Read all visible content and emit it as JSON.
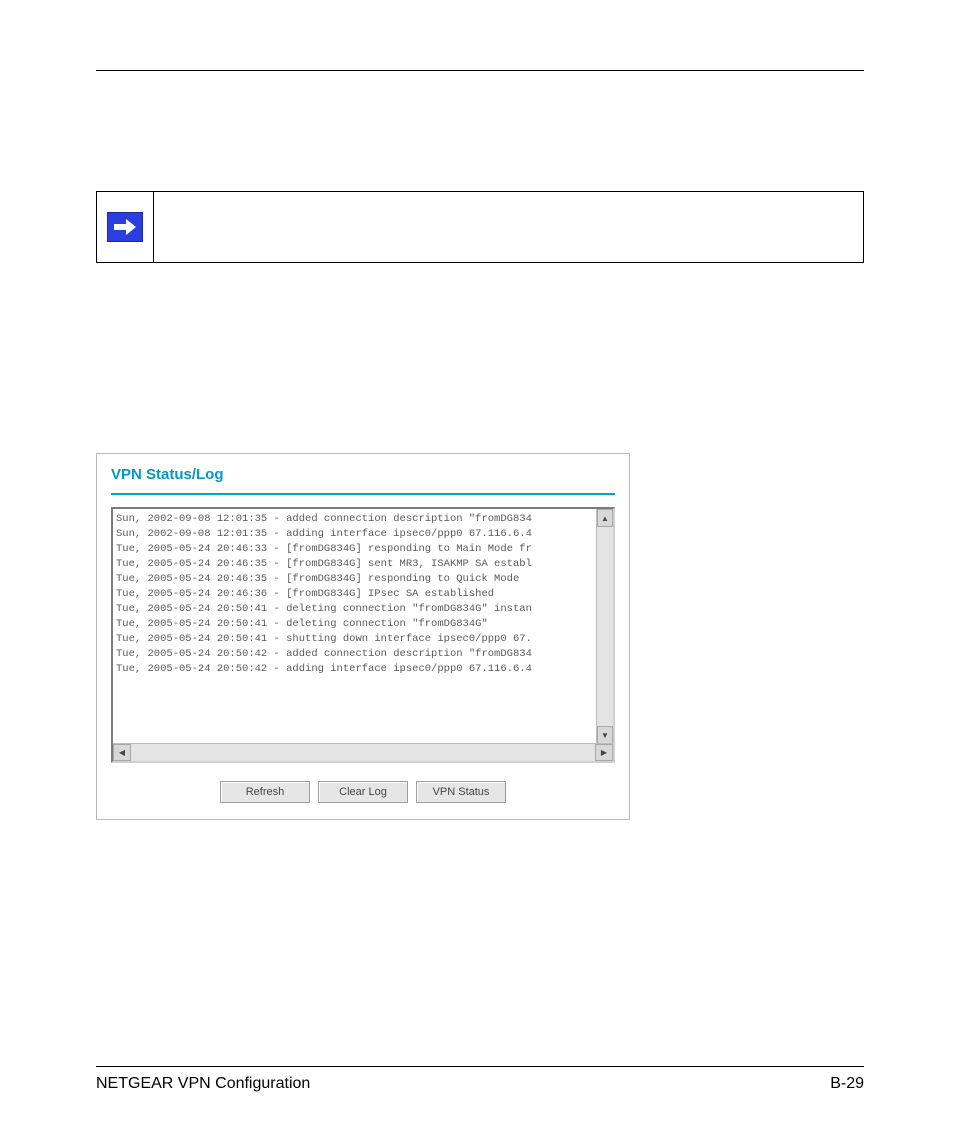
{
  "panel": {
    "title": "VPN Status/Log",
    "log_lines": [
      "Sun, 2002-09-08 12:01:35 - added connection description \"fromDG834",
      "Sun, 2002-09-08 12:01:35 - adding interface ipsec0/ppp0 67.116.6.4",
      "Tue, 2005-05-24 20:46:33 - [fromDG834G] responding to Main Mode fr",
      "Tue, 2005-05-24 20:46:35 - [fromDG834G] sent MR3, ISAKMP SA establ",
      "Tue, 2005-05-24 20:46:35 - [fromDG834G] responding to Quick Mode",
      "Tue, 2005-05-24 20:46:36 - [fromDG834G] IPsec SA established",
      "Tue, 2005-05-24 20:50:41 - deleting connection \"fromDG834G\" instan",
      "Tue, 2005-05-24 20:50:41 - deleting connection \"fromDG834G\"",
      "Tue, 2005-05-24 20:50:41 - shutting down interface ipsec0/ppp0 67.",
      "Tue, 2005-05-24 20:50:42 - added connection description \"fromDG834",
      "Tue, 2005-05-24 20:50:42 - adding interface ipsec0/ppp0 67.116.6.4"
    ],
    "buttons": {
      "refresh": "Refresh",
      "clear_log": "Clear Log",
      "vpn_status": "VPN Status"
    }
  },
  "footer": {
    "left": "NETGEAR VPN Configuration",
    "right": "B-29"
  }
}
